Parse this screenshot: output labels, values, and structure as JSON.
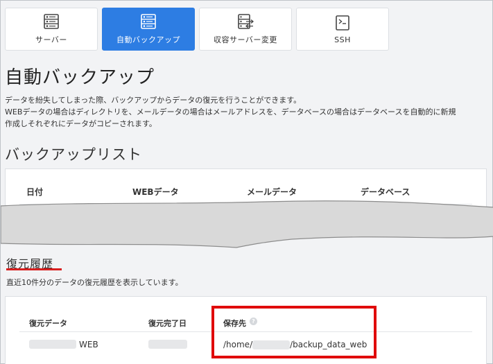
{
  "tabs": [
    {
      "label": "サーバー",
      "icon": "server-list-icon",
      "active": false
    },
    {
      "label": "自動バックアップ",
      "icon": "backup-icon",
      "active": true
    },
    {
      "label": "収容サーバー変更",
      "icon": "server-move-icon",
      "active": false
    },
    {
      "label": "SSH",
      "icon": "terminal-icon",
      "active": false
    }
  ],
  "page": {
    "title": "自動バックアップ",
    "desc_line1": "データを紛失してしまった際、バックアップからデータの復元を行うことができます。",
    "desc_line2": "WEBデータの場合はディレクトリを、メールデータの場合はメールアドレスを、データベースの場合はデータベースを自動的に新規",
    "desc_line3": "作成しそれぞれにデータがコピーされます。"
  },
  "backup_list": {
    "title": "バックアップリスト",
    "columns": [
      "日付",
      "WEBデータ",
      "メールデータ",
      "データベース"
    ]
  },
  "restore_history": {
    "title": "復元履歴",
    "desc": "直近10件分のデータの復元履歴を表示しています。",
    "columns": [
      "復元データ",
      "復元完了日",
      "保存先"
    ],
    "help_glyph": "?",
    "rows": [
      {
        "data_type": "WEB",
        "path_prefix": "/home/",
        "path_suffix": "/backup_data_web"
      }
    ]
  },
  "colors": {
    "accent": "#2d7de3",
    "highlight_red": "#e00a0a"
  }
}
